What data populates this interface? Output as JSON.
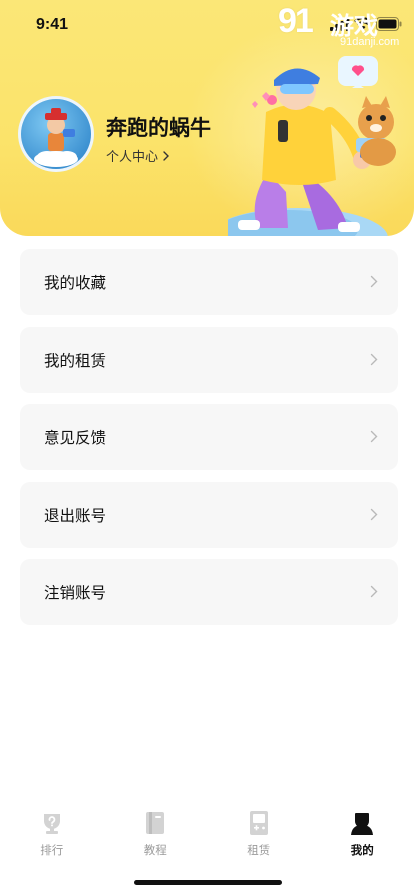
{
  "status_bar": {
    "time": "9:41"
  },
  "watermark": {
    "logo": "91",
    "text": "游戏",
    "url": "91danji.com"
  },
  "profile": {
    "username": "奔跑的蜗牛",
    "link_label": "个人中心"
  },
  "menu": {
    "items": [
      {
        "label": "我的收藏"
      },
      {
        "label": "我的租赁"
      },
      {
        "label": "意见反馈"
      },
      {
        "label": "退出账号"
      },
      {
        "label": "注销账号"
      }
    ]
  },
  "tabbar": {
    "items": [
      {
        "label": "排行",
        "icon": "ranking-icon",
        "active": false
      },
      {
        "label": "教程",
        "icon": "book-icon",
        "active": false
      },
      {
        "label": "租赁",
        "icon": "gamepad-icon",
        "active": false
      },
      {
        "label": "我的",
        "icon": "profile-icon",
        "active": true
      }
    ]
  },
  "colors": {
    "header_yellow": "#fbe36a",
    "card_bg": "#f7f7f7",
    "tab_inactive": "#9a9a9a",
    "tab_active": "#111111"
  }
}
